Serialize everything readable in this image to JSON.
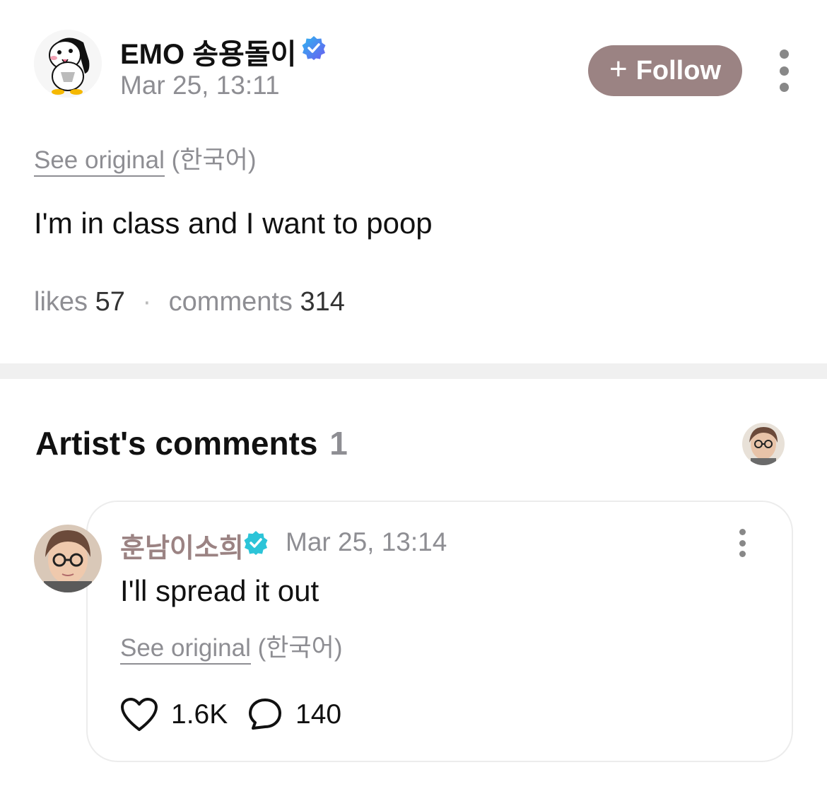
{
  "post": {
    "author_name": "EMO 송용돌이",
    "timestamp": "Mar 25, 13:11",
    "follow_label": "Follow",
    "see_original": "See original",
    "language": "(한국어)",
    "body": "I'm in class and I want to poop",
    "likes_label": "likes",
    "likes_count": "57",
    "comments_label": "comments",
    "comments_count": "314"
  },
  "artist_comments": {
    "title": "Artist's comments",
    "count": "1",
    "comment": {
      "author_name": "훈남이소희",
      "timestamp": "Mar 25, 13:14",
      "text": "I'll spread it out",
      "see_original": "See original",
      "language": "(한국어)",
      "likes": "1.6K",
      "replies": "140"
    }
  },
  "colors": {
    "follow_button": "#9b8383",
    "verified_blue": "#4f6ef7",
    "verified_teal": "#2cc4d8",
    "muted_text": "#8e8e93",
    "divider": "#f0f0f0"
  },
  "icons": [
    "verified-badge-icon",
    "plus-icon",
    "more-vertical-icon",
    "heart-icon",
    "comment-bubble-icon"
  ]
}
